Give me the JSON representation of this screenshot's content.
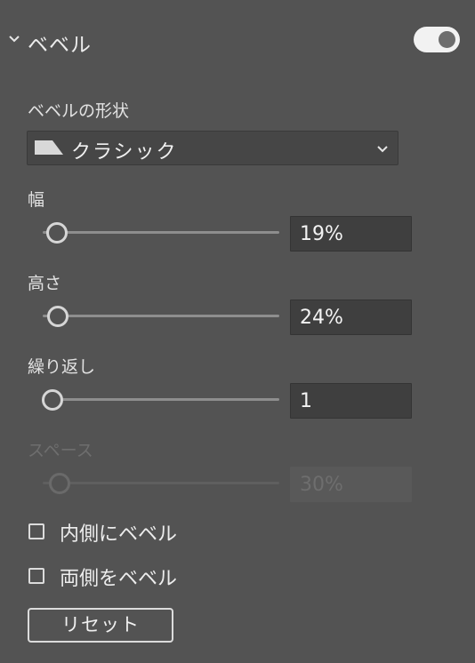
{
  "section": {
    "title": "ベベル",
    "enabled": true
  },
  "shape": {
    "label": "ベベルの形状",
    "value": "クラシック",
    "icon": "classic-bevel-shape-icon"
  },
  "width": {
    "label": "幅",
    "value_text": "19%",
    "slider_value": 19
  },
  "height": {
    "label": "高さ",
    "value_text": "24%",
    "slider_value": 24
  },
  "repeat": {
    "label": "繰り返し",
    "value_text": "1",
    "slider_value": 0
  },
  "space": {
    "label": "スペース",
    "value_text": "30%",
    "slider_value": 30,
    "disabled": true
  },
  "options": {
    "inner_bevel_label": "内側にベベル",
    "inner_bevel_checked": false,
    "both_sides_label": "両側をベベル",
    "both_sides_checked": false
  },
  "reset_label": "リセット",
  "colors": {
    "panel_bg": "#535353",
    "field_bg": "#3f3f3f",
    "text": "#e4e4e4",
    "disabled_text": "#6e6e6e"
  }
}
